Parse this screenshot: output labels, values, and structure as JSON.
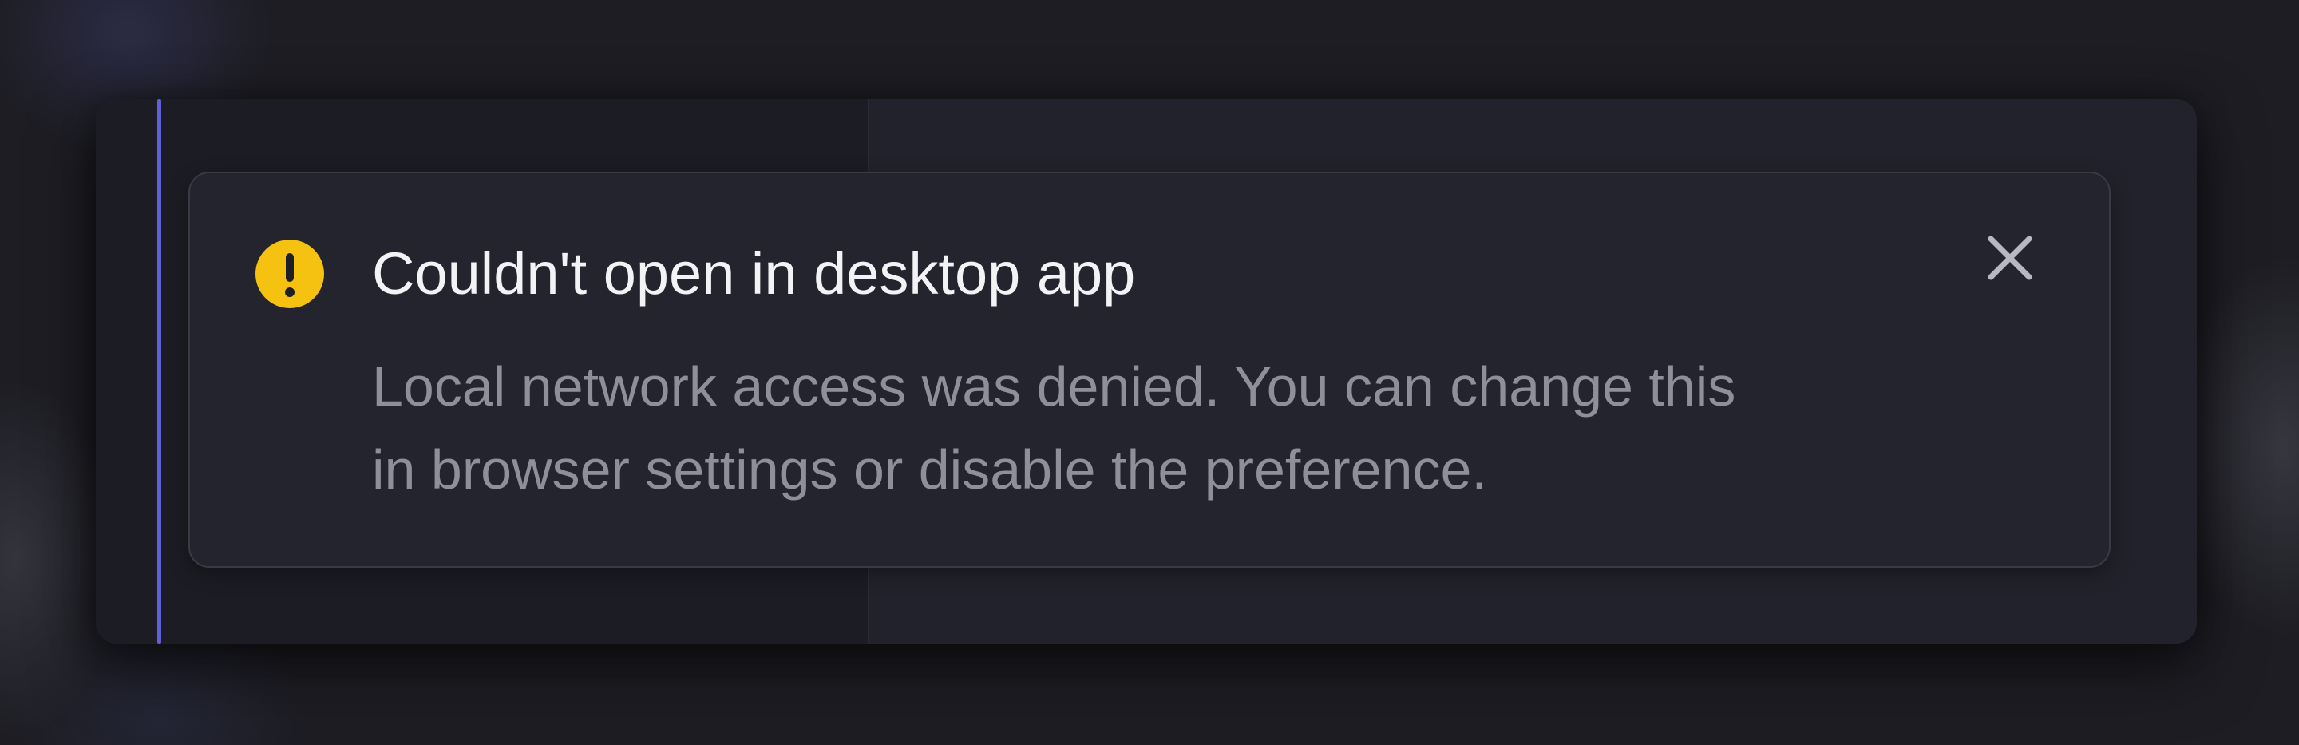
{
  "toast": {
    "title": "Couldn't open in desktop app",
    "message_lines": [
      "Local network access was denied. You can change this",
      "in browser settings or disable the preference."
    ],
    "icon": "warning-icon",
    "close_icon": "close-icon"
  },
  "colors": {
    "background": "#1d1d23",
    "window": "#22222c",
    "sidebar": "#1c1c24",
    "toast_bg": "#24242f",
    "toast_border": "#3a3a47",
    "accent": "#6060d8",
    "warning": "#f5c211",
    "title_text": "#f3f3f6",
    "body_text": "#8f8f9c",
    "close_icon": "#b8b8c2"
  }
}
